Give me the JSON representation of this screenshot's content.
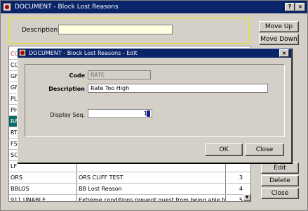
{
  "main_window": {
    "title": "DOCUMENT - Block Lost Reasons",
    "search_label": "Description",
    "search_value": "",
    "buttons": {
      "move_up": "Move Up",
      "move_down": "Move Down",
      "edit": "Edit",
      "delete": "Delete",
      "close": "Close"
    }
  },
  "table": {
    "rows": [
      {
        "code": "CO",
        "description": "",
        "seq": ""
      },
      {
        "code": "CO",
        "description": "",
        "seq": ""
      },
      {
        "code": "GF",
        "description": "",
        "seq": ""
      },
      {
        "code": "GF",
        "description": "",
        "seq": ""
      },
      {
        "code": "PL",
        "description": "",
        "seq": ""
      },
      {
        "code": "PH",
        "description": "",
        "seq": ""
      },
      {
        "code": "RA",
        "description": "",
        "seq": ""
      },
      {
        "code": "RT",
        "description": "",
        "seq": ""
      },
      {
        "code": "FS",
        "description": "",
        "seq": ""
      },
      {
        "code": "SO",
        "description": "",
        "seq": ""
      },
      {
        "code": "LF",
        "description": "",
        "seq": ""
      },
      {
        "code": "ORS",
        "description": "ORS CLIFF TEST",
        "seq": "3"
      },
      {
        "code": "BBLOS",
        "description": "BB Lost Reason",
        "seq": "4"
      },
      {
        "code": "911 UNABLE",
        "description": "Extreme conditions prevent guest from being able to",
        "seq": "5"
      }
    ]
  },
  "dialog": {
    "title": "DOCUMENT - Block Lost Reasons - Edit",
    "code_label": "Code",
    "code_value": "RATE",
    "description_label": "Description",
    "description_value": "Rate Too High",
    "display_seq_label": "Display Seq.",
    "display_seq_value": "1",
    "ok_label": "OK",
    "close_label": "Close"
  },
  "icons": [
    "app-icon",
    "close-icon",
    "help-icon",
    "scroll-down-icon"
  ]
}
